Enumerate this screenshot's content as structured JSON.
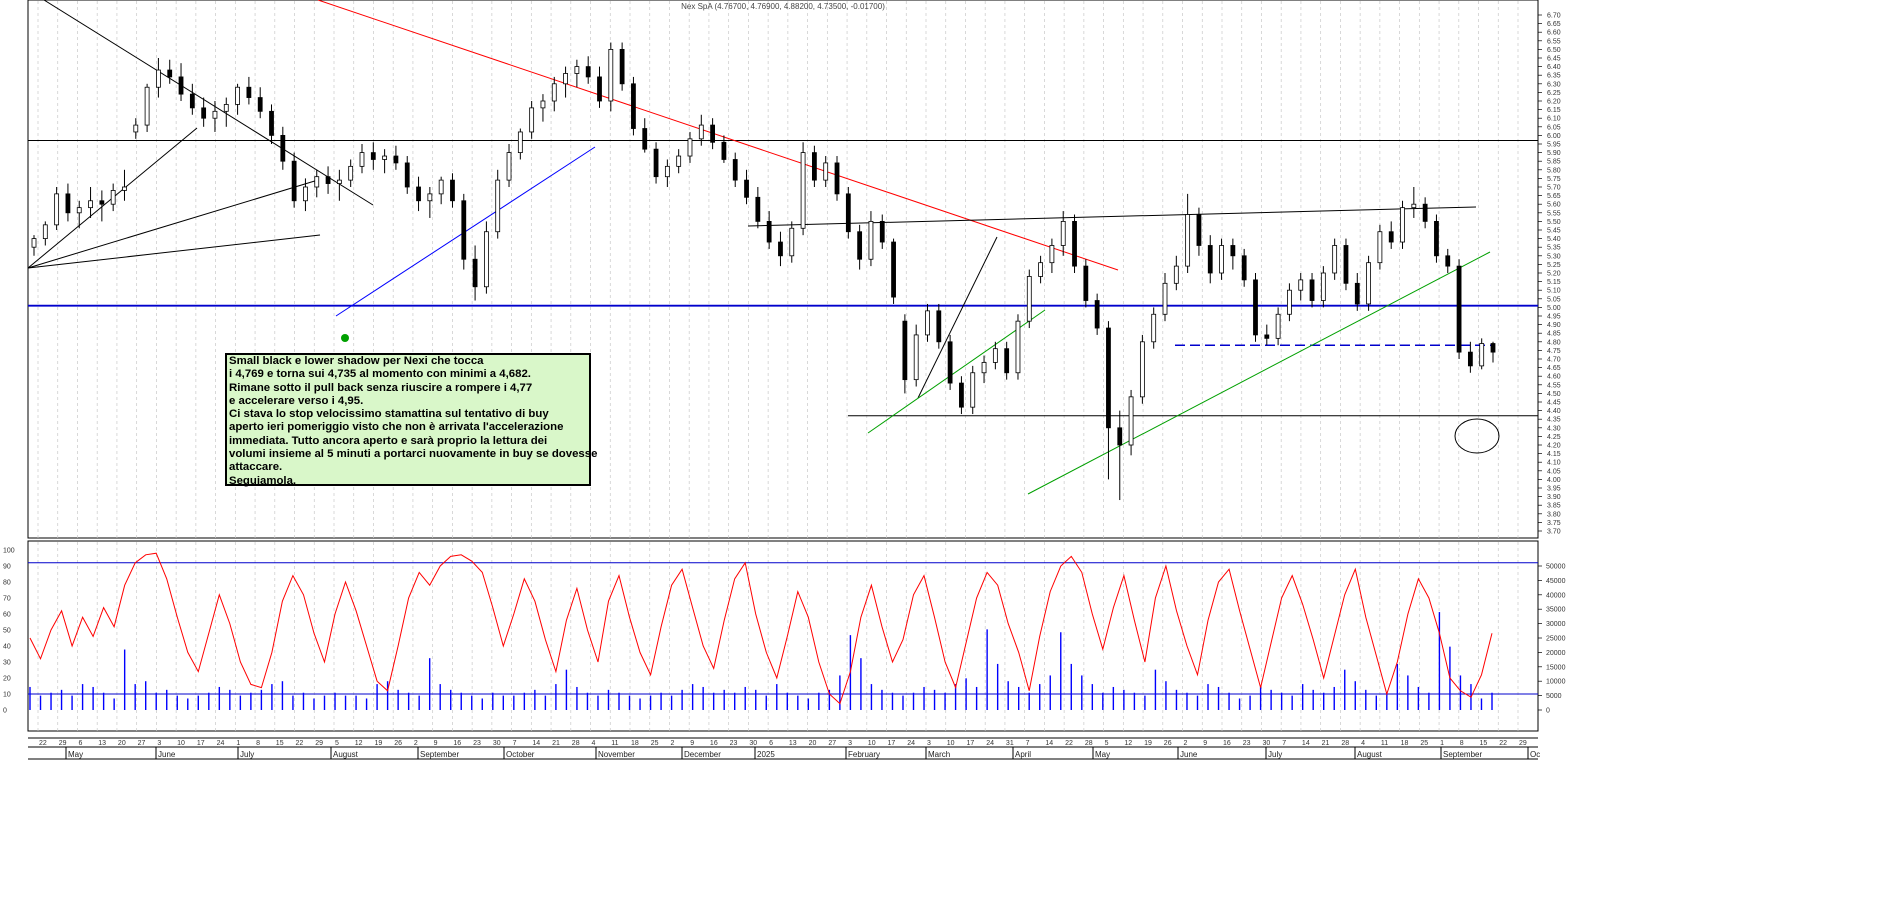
{
  "title": "Nex SpA (4.76700, 4.76900, 4.88200, 4.73500, -0.01700)",
  "colors": {
    "candle": "#000000",
    "resistance_line": "#ff0000",
    "support_line_blue": "#0000ff",
    "support_line_green": "#00a000",
    "horizontal_level": "#0000cc",
    "oscillator": "#ff0000",
    "volume": "#0000ff",
    "note_background": "#d9f7c9"
  },
  "annotation_box": {
    "lines": [
      "Small black e lower shadow per Nexi che tocca",
      "i 4,769 e torna sui 4,735 al momento con minimi a 4,682.",
      "Rimane sotto il pull back senza riuscire a rompere i 4,77",
      "e accelerare verso i 4,95.",
      "Ci stava lo stop velocissimo stamattina sul tentativo di buy",
      "aperto ieri pomeriggio visto che non è arrivata l'accelerazione",
      "immediata. Tutto ancora aperto e sarà proprio la lettura dei",
      "volumi insieme al 5 minuti a portarci nuovamente in buy se dovesse",
      "attaccare.",
      "Seguiamola."
    ]
  },
  "chart_data": [
    {
      "type": "candlestick",
      "title": "Nex SpA (4.76700, 4.76900, 4.88200, 4.73500, -0.01700)",
      "y_ticks": [
        "6.70",
        "6.65",
        "6.60",
        "6.55",
        "6.50",
        "6.45",
        "6.40",
        "6.35",
        "6.30",
        "6.25",
        "6.20",
        "6.15",
        "6.10",
        "6.05",
        "6.00",
        "5.95",
        "5.90",
        "5.85",
        "5.80",
        "5.75",
        "5.70",
        "5.65",
        "5.60",
        "5.55",
        "5.50",
        "5.45",
        "5.40",
        "5.35",
        "5.30",
        "5.25",
        "5.20",
        "5.15",
        "5.10",
        "5.05",
        "5.00",
        "4.95",
        "4.90",
        "4.85",
        "4.80",
        "4.75",
        "4.70",
        "4.65",
        "4.60",
        "4.55",
        "4.50",
        "4.45",
        "4.40",
        "4.35",
        "4.30",
        "4.25",
        "4.20",
        "4.15",
        "4.10",
        "4.05",
        "4.00",
        "3.95",
        "3.90",
        "3.85",
        "3.80",
        "3.75",
        "3.70"
      ],
      "ylim": [
        3.66,
        6.72
      ],
      "day_ticks": [
        "22",
        "29",
        "6",
        "13",
        "20",
        "27",
        "3",
        "10",
        "17",
        "24",
        "1",
        "8",
        "15",
        "22",
        "29",
        "5",
        "12",
        "19",
        "26",
        "2",
        "9",
        "16",
        "23",
        "30",
        "7",
        "14",
        "21",
        "28",
        "4",
        "11",
        "18",
        "25",
        "2",
        "9",
        "16",
        "23",
        "30",
        "6",
        "13",
        "20",
        "27",
        "3",
        "10",
        "17",
        "24",
        "3",
        "10",
        "17",
        "24",
        "31",
        "7",
        "14",
        "22",
        "28",
        "5",
        "12",
        "19",
        "26",
        "2",
        "9",
        "16",
        "23",
        "30",
        "7",
        "14",
        "21",
        "28",
        "4",
        "11",
        "18",
        "25",
        "1",
        "8",
        "15",
        "22",
        "29"
      ],
      "month_labels": [
        "May",
        "June",
        "July",
        "August",
        "September",
        "October",
        "November",
        "December",
        "2025",
        "February",
        "March",
        "April",
        "May",
        "June",
        "July",
        "August",
        "September",
        "Oc"
      ],
      "horizontal_levels": [
        5.97,
        5.01,
        4.37,
        4.78
      ],
      "points": [
        [
          5.35,
          5.42,
          5.3,
          5.4
        ],
        [
          5.4,
          5.5,
          5.36,
          5.48
        ],
        [
          5.48,
          5.7,
          5.45,
          5.66
        ],
        [
          5.66,
          5.72,
          5.5,
          5.55
        ],
        [
          5.55,
          5.62,
          5.46,
          5.58
        ],
        [
          5.58,
          5.7,
          5.52,
          5.62
        ],
        [
          5.62,
          5.68,
          5.5,
          5.6
        ],
        [
          5.6,
          5.72,
          5.56,
          5.68
        ],
        [
          5.68,
          5.8,
          5.62,
          5.7
        ],
        [
          6.02,
          6.1,
          5.98,
          6.06
        ],
        [
          6.06,
          6.3,
          6.02,
          6.28
        ],
        [
          6.28,
          6.45,
          6.22,
          6.38
        ],
        [
          6.38,
          6.44,
          6.3,
          6.34
        ],
        [
          6.34,
          6.42,
          6.2,
          6.24
        ],
        [
          6.24,
          6.3,
          6.12,
          6.16
        ],
        [
          6.16,
          6.22,
          6.05,
          6.1
        ],
        [
          6.1,
          6.2,
          6.02,
          6.14
        ],
        [
          6.14,
          6.22,
          6.05,
          6.18
        ],
        [
          6.18,
          6.3,
          6.12,
          6.28
        ],
        [
          6.28,
          6.34,
          6.18,
          6.22
        ],
        [
          6.22,
          6.28,
          6.1,
          6.14
        ],
        [
          6.14,
          6.18,
          5.95,
          6.0
        ],
        [
          6.0,
          6.05,
          5.8,
          5.85
        ],
        [
          5.85,
          5.9,
          5.58,
          5.62
        ],
        [
          5.62,
          5.75,
          5.56,
          5.7
        ],
        [
          5.7,
          5.8,
          5.64,
          5.76
        ],
        [
          5.76,
          5.82,
          5.66,
          5.72
        ],
        [
          5.72,
          5.8,
          5.62,
          5.74
        ],
        [
          5.74,
          5.86,
          5.7,
          5.82
        ],
        [
          5.82,
          5.95,
          5.78,
          5.9
        ],
        [
          5.9,
          5.96,
          5.8,
          5.86
        ],
        [
          5.86,
          5.92,
          5.78,
          5.88
        ],
        [
          5.88,
          5.94,
          5.8,
          5.84
        ],
        [
          5.84,
          5.88,
          5.66,
          5.7
        ],
        [
          5.7,
          5.76,
          5.56,
          5.62
        ],
        [
          5.62,
          5.7,
          5.52,
          5.66
        ],
        [
          5.66,
          5.76,
          5.6,
          5.74
        ],
        [
          5.74,
          5.78,
          5.58,
          5.62
        ],
        [
          5.62,
          5.66,
          5.22,
          5.28
        ],
        [
          5.28,
          5.36,
          5.04,
          5.12
        ],
        [
          5.12,
          5.5,
          5.08,
          5.44
        ],
        [
          5.44,
          5.8,
          5.4,
          5.74
        ],
        [
          5.74,
          5.95,
          5.7,
          5.9
        ],
        [
          5.9,
          6.04,
          5.86,
          6.02
        ],
        [
          6.02,
          6.2,
          5.98,
          6.16
        ],
        [
          6.16,
          6.24,
          6.08,
          6.2
        ],
        [
          6.2,
          6.34,
          6.14,
          6.3
        ],
        [
          6.3,
          6.4,
          6.22,
          6.36
        ],
        [
          6.36,
          6.44,
          6.28,
          6.4
        ],
        [
          6.4,
          6.46,
          6.3,
          6.34
        ],
        [
          6.34,
          6.4,
          6.16,
          6.2
        ],
        [
          6.2,
          6.54,
          6.14,
          6.5
        ],
        [
          6.5,
          6.54,
          6.26,
          6.3
        ],
        [
          6.3,
          6.34,
          6.0,
          6.04
        ],
        [
          6.04,
          6.1,
          5.9,
          5.92
        ],
        [
          5.92,
          5.96,
          5.72,
          5.76
        ],
        [
          5.76,
          5.86,
          5.7,
          5.82
        ],
        [
          5.82,
          5.92,
          5.78,
          5.88
        ],
        [
          5.88,
          6.02,
          5.84,
          5.98
        ],
        [
          5.98,
          6.12,
          5.94,
          6.06
        ],
        [
          6.06,
          6.1,
          5.92,
          5.96
        ],
        [
          5.96,
          6.0,
          5.84,
          5.86
        ],
        [
          5.86,
          5.9,
          5.7,
          5.74
        ],
        [
          5.74,
          5.8,
          5.6,
          5.64
        ],
        [
          5.64,
          5.7,
          5.46,
          5.5
        ],
        [
          5.5,
          5.56,
          5.34,
          5.38
        ],
        [
          5.38,
          5.44,
          5.24,
          5.3
        ],
        [
          5.3,
          5.5,
          5.26,
          5.46
        ],
        [
          5.46,
          5.96,
          5.42,
          5.9
        ],
        [
          5.9,
          5.94,
          5.7,
          5.74
        ],
        [
          5.74,
          5.88,
          5.7,
          5.84
        ],
        [
          5.84,
          5.88,
          5.62,
          5.66
        ],
        [
          5.66,
          5.7,
          5.4,
          5.44
        ],
        [
          5.44,
          5.48,
          5.22,
          5.28
        ],
        [
          5.28,
          5.56,
          5.24,
          5.5
        ],
        [
          5.5,
          5.54,
          5.34,
          5.38
        ],
        [
          5.38,
          5.4,
          5.02,
          5.06
        ],
        [
          4.92,
          4.96,
          4.5,
          4.58
        ],
        [
          4.58,
          4.9,
          4.54,
          4.84
        ],
        [
          4.84,
          5.02,
          4.8,
          4.98
        ],
        [
          4.98,
          5.02,
          4.76,
          4.8
        ],
        [
          4.8,
          4.84,
          4.52,
          4.56
        ],
        [
          4.56,
          4.6,
          4.38,
          4.42
        ],
        [
          4.42,
          4.66,
          4.38,
          4.62
        ],
        [
          4.62,
          4.72,
          4.56,
          4.68
        ],
        [
          4.68,
          4.8,
          4.64,
          4.76
        ],
        [
          4.76,
          4.8,
          4.58,
          4.62
        ],
        [
          4.62,
          4.96,
          4.58,
          4.92
        ],
        [
          4.92,
          5.22,
          4.88,
          5.18
        ],
        [
          5.18,
          5.3,
          5.14,
          5.26
        ],
        [
          5.26,
          5.4,
          5.2,
          5.36
        ],
        [
          5.36,
          5.56,
          5.3,
          5.5
        ],
        [
          5.5,
          5.54,
          5.2,
          5.24
        ],
        [
          5.24,
          5.28,
          5.0,
          5.04
        ],
        [
          5.04,
          5.08,
          4.84,
          4.88
        ],
        [
          4.88,
          4.92,
          4.0,
          4.3
        ],
        [
          4.3,
          4.4,
          3.88,
          4.2
        ],
        [
          4.2,
          4.52,
          4.14,
          4.48
        ],
        [
          4.48,
          4.84,
          4.44,
          4.8
        ],
        [
          4.8,
          5.0,
          4.76,
          4.96
        ],
        [
          4.96,
          5.2,
          4.92,
          5.14
        ],
        [
          5.14,
          5.3,
          5.1,
          5.24
        ],
        [
          5.24,
          5.66,
          5.2,
          5.54
        ],
        [
          5.54,
          5.58,
          5.3,
          5.36
        ],
        [
          5.36,
          5.42,
          5.14,
          5.2
        ],
        [
          5.2,
          5.4,
          5.16,
          5.36
        ],
        [
          5.36,
          5.4,
          5.22,
          5.3
        ],
        [
          5.3,
          5.34,
          5.12,
          5.16
        ],
        [
          5.16,
          5.2,
          4.8,
          4.84
        ],
        [
          4.84,
          4.9,
          4.78,
          4.82
        ],
        [
          4.82,
          5.0,
          4.78,
          4.96
        ],
        [
          4.96,
          5.14,
          4.92,
          5.1
        ],
        [
          5.1,
          5.2,
          5.04,
          5.16
        ],
        [
          5.16,
          5.2,
          5.0,
          5.04
        ],
        [
          5.04,
          5.24,
          5.0,
          5.2
        ],
        [
          5.2,
          5.4,
          5.16,
          5.36
        ],
        [
          5.36,
          5.4,
          5.1,
          5.14
        ],
        [
          5.14,
          5.2,
          4.98,
          5.02
        ],
        [
          5.02,
          5.3,
          4.98,
          5.26
        ],
        [
          5.26,
          5.48,
          5.22,
          5.44
        ],
        [
          5.44,
          5.5,
          5.34,
          5.38
        ],
        [
          5.38,
          5.62,
          5.34,
          5.58
        ],
        [
          5.58,
          5.7,
          5.52,
          5.6
        ],
        [
          5.6,
          5.64,
          5.46,
          5.5
        ],
        [
          5.5,
          5.54,
          5.26,
          5.3
        ],
        [
          5.3,
          5.34,
          5.2,
          5.24
        ],
        [
          5.24,
          5.28,
          4.7,
          4.74
        ],
        [
          4.74,
          4.8,
          4.62,
          4.66
        ],
        [
          4.66,
          4.82,
          4.64,
          4.79
        ],
        [
          4.79,
          4.8,
          4.68,
          4.74
        ]
      ]
    },
    {
      "type": "line+bar",
      "y_ticks_left": [
        "100",
        "90",
        "80",
        "70",
        "60",
        "50",
        "40",
        "30",
        "20",
        "10",
        "0"
      ],
      "ylim_left": [
        0,
        100
      ],
      "y_ticks_right": [
        "50000",
        "45000",
        "40000",
        "35000",
        "30000",
        "25000",
        "20000",
        "15000",
        "10000",
        "5000",
        "0"
      ],
      "ylim_right": [
        0,
        50000
      ],
      "horizontal_levels": [
        92,
        10
      ],
      "oscillator": [
        45,
        32,
        50,
        62,
        40,
        58,
        46,
        64,
        52,
        78,
        92,
        97,
        98,
        82,
        58,
        36,
        24,
        48,
        72,
        54,
        30,
        16,
        14,
        36,
        68,
        84,
        72,
        48,
        30,
        60,
        80,
        62,
        40,
        18,
        12,
        40,
        70,
        86,
        78,
        90,
        96,
        97,
        93,
        86,
        64,
        40,
        60,
        82,
        68,
        44,
        24,
        56,
        76,
        50,
        30,
        68,
        84,
        58,
        36,
        22,
        52,
        78,
        88,
        64,
        40,
        26,
        56,
        82,
        92,
        60,
        36,
        20,
        46,
        74,
        58,
        30,
        10,
        4,
        24,
        58,
        78,
        52,
        30,
        44,
        72,
        84,
        58,
        30,
        14,
        42,
        70,
        86,
        78,
        54,
        36,
        12,
        46,
        74,
        90,
        96,
        86,
        60,
        38,
        64,
        84,
        56,
        30,
        70,
        90,
        62,
        40,
        22,
        56,
        80,
        88,
        62,
        38,
        14,
        42,
        70,
        84,
        66,
        44,
        20,
        46,
        72,
        88,
        58,
        34,
        10,
        30,
        60,
        82,
        70,
        48,
        20,
        12,
        8,
        22,
        48
      ],
      "volume": [
        8000,
        5000,
        6000,
        7000,
        5000,
        9000,
        8000,
        6000,
        4000,
        21000,
        9000,
        10000,
        6000,
        7000,
        5000,
        4000,
        5000,
        6000,
        8000,
        7000,
        5000,
        6000,
        7000,
        9000,
        10000,
        5000,
        6000,
        4000,
        5000,
        6000,
        5000,
        5000,
        4000,
        9000,
        10000,
        7000,
        6000,
        5000,
        18000,
        9000,
        7000,
        6000,
        5000,
        4000,
        6000,
        5000,
        5000,
        6000,
        7000,
        5000,
        9000,
        14000,
        8000,
        6000,
        5000,
        7000,
        6000,
        5000,
        4000,
        5000,
        6000,
        5000,
        7000,
        9000,
        8000,
        6000,
        7000,
        6000,
        8000,
        7000,
        5000,
        9000,
        6000,
        5000,
        4000,
        6000,
        7000,
        12000,
        26000,
        18000,
        9000,
        7000,
        6000,
        5000,
        6000,
        8000,
        7000,
        6000,
        9000,
        11000,
        8000,
        28000,
        16000,
        10000,
        8000,
        6000,
        9000,
        12000,
        27000,
        16000,
        12000,
        9000,
        6000,
        8000,
        7000,
        6000,
        5000,
        14000,
        10000,
        7000,
        6000,
        5000,
        9000,
        8000,
        6000,
        4000,
        5000,
        8000,
        7000,
        6000,
        5000,
        9000,
        7000,
        6000,
        8000,
        14000,
        10000,
        7000,
        5000,
        6000,
        16000,
        12000,
        8000,
        6000,
        34000,
        22000,
        12000,
        9000,
        4000,
        6000
      ]
    }
  ]
}
